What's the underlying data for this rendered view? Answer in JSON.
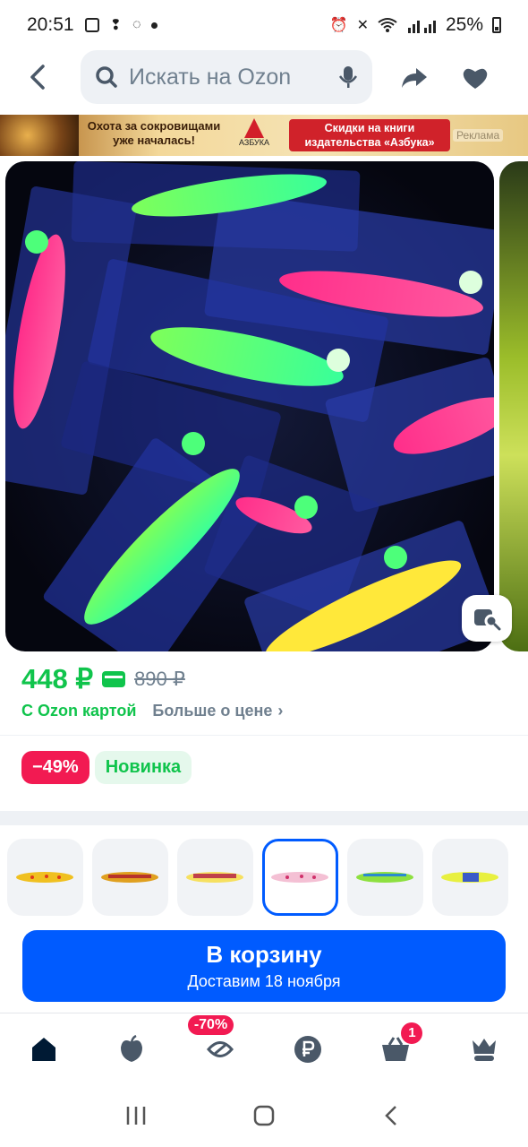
{
  "status_bar": {
    "time": "20:51",
    "battery": "25%"
  },
  "search": {
    "placeholder": "Искать на Ozon"
  },
  "banner": {
    "text_left": "Охота за сокровищами уже началась!",
    "logo_text": "АЗБУКА",
    "promo": "Скидки на книги издательства «Азбука»",
    "ad_label": "Реклама"
  },
  "product": {
    "price": "448 ₽",
    "old_price": "890 ₽",
    "ozon_card": "С Ozon картой",
    "more_price": "Больше о цене",
    "discount_badge": "−49%",
    "new_badge": "Новинка",
    "thumb_count": 6,
    "active_thumb": 4
  },
  "cart": {
    "label": "В корзину",
    "delivery": "Доставим 18 ноября"
  },
  "bottom_nav": {
    "items": [
      {
        "name": "home"
      },
      {
        "name": "fresh"
      },
      {
        "name": "sale",
        "badge": "-70%"
      },
      {
        "name": "finance"
      },
      {
        "name": "cart",
        "badge": "1"
      },
      {
        "name": "profile"
      }
    ]
  },
  "colors": {
    "accent": "#005bff",
    "green": "#10c44c",
    "red": "#f21a52"
  }
}
